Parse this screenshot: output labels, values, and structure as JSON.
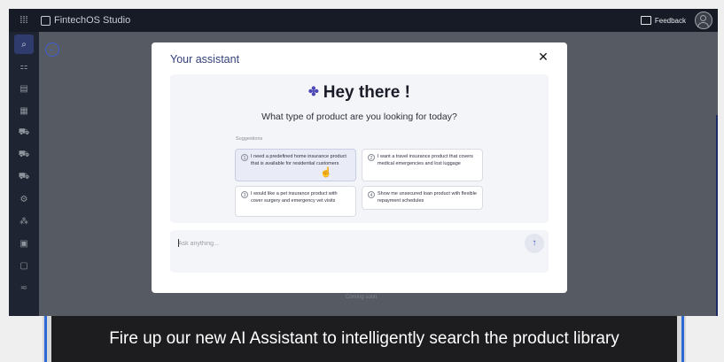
{
  "app": {
    "name": "FintechOS Studio",
    "feedback_label": "Feedback",
    "footer_text": "Coming soon"
  },
  "sidebar": {
    "items": [
      {
        "icon": "search-icon",
        "glyph": "⌕"
      },
      {
        "icon": "apps-icon",
        "glyph": "⚏"
      },
      {
        "icon": "clipboard-icon",
        "glyph": "▤"
      },
      {
        "icon": "table-icon",
        "glyph": "▦"
      },
      {
        "icon": "cart-icon",
        "glyph": "⛟"
      },
      {
        "icon": "cart-outline-icon",
        "glyph": "⛟"
      },
      {
        "icon": "truck-icon",
        "glyph": "⛟"
      },
      {
        "icon": "settings-icon",
        "glyph": "⚙"
      },
      {
        "icon": "nodes-icon",
        "glyph": "⁂"
      },
      {
        "icon": "calendar-icon",
        "glyph": "▣"
      },
      {
        "icon": "document-icon",
        "glyph": "▢"
      },
      {
        "icon": "sliders-icon",
        "glyph": "≂"
      }
    ]
  },
  "modal": {
    "title": "Your assistant",
    "close_glyph": "✕",
    "greeting": "Hey there !",
    "question": "What type of product are you looking for today?",
    "suggestions_label": "Suggestions",
    "suggestions": [
      {
        "num": "1",
        "text": "I need a predefined home insurance product that is available for residential customers"
      },
      {
        "num": "2",
        "text": "I want a travel insurance product that covers medical emergencies and lost luggage"
      },
      {
        "num": "3",
        "text": "I would like a pet insurance product with cover surgery and emergency vet visits"
      },
      {
        "num": "4",
        "text": "Show me unsecured loan product with flexible repayment schedules"
      }
    ],
    "input_placeholder": "Ask anything...",
    "send_glyph": "↑"
  },
  "caption": {
    "text": "Fire up our new AI Assistant to intelligently search the product library"
  },
  "colors": {
    "accent": "#3f4fc4",
    "topbar": "#161b26",
    "sidebar": "#1e2431",
    "caption_bg": "#1d1d1f",
    "caption_accent": "#2e6ad6"
  }
}
